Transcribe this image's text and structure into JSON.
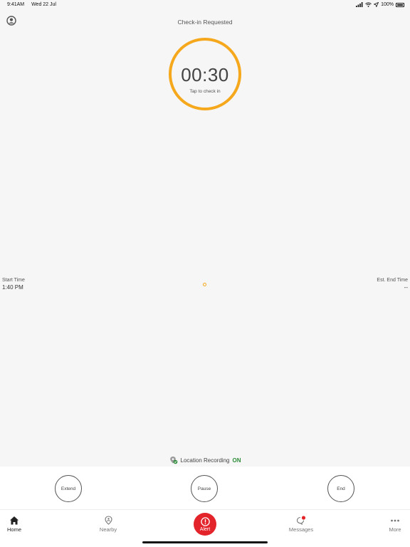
{
  "status_bar": {
    "time": "9:41AM",
    "date": "Wed 22 Jul",
    "battery": "100%"
  },
  "header": {
    "title": "Check-in Requested"
  },
  "timer": {
    "value": "00:30",
    "hint": "Tap to check in",
    "ring_color": "#f6a81c"
  },
  "session": {
    "start_label": "Start Time",
    "start_value": "1:40 PM",
    "end_label": "Est. End Time",
    "end_value": "--"
  },
  "location": {
    "label": "Location Recording",
    "status": "ON",
    "status_color": "#2e8b3a"
  },
  "controls": {
    "extend_label": "Extend",
    "pause_label": "Pause",
    "end_label": "End"
  },
  "tabs": {
    "home": "Home",
    "nearby": "Nearby",
    "alert": "Alert",
    "messages": "Messages",
    "more": "More"
  },
  "colors": {
    "alert": "#e3242b",
    "background": "#f6f6f6"
  }
}
